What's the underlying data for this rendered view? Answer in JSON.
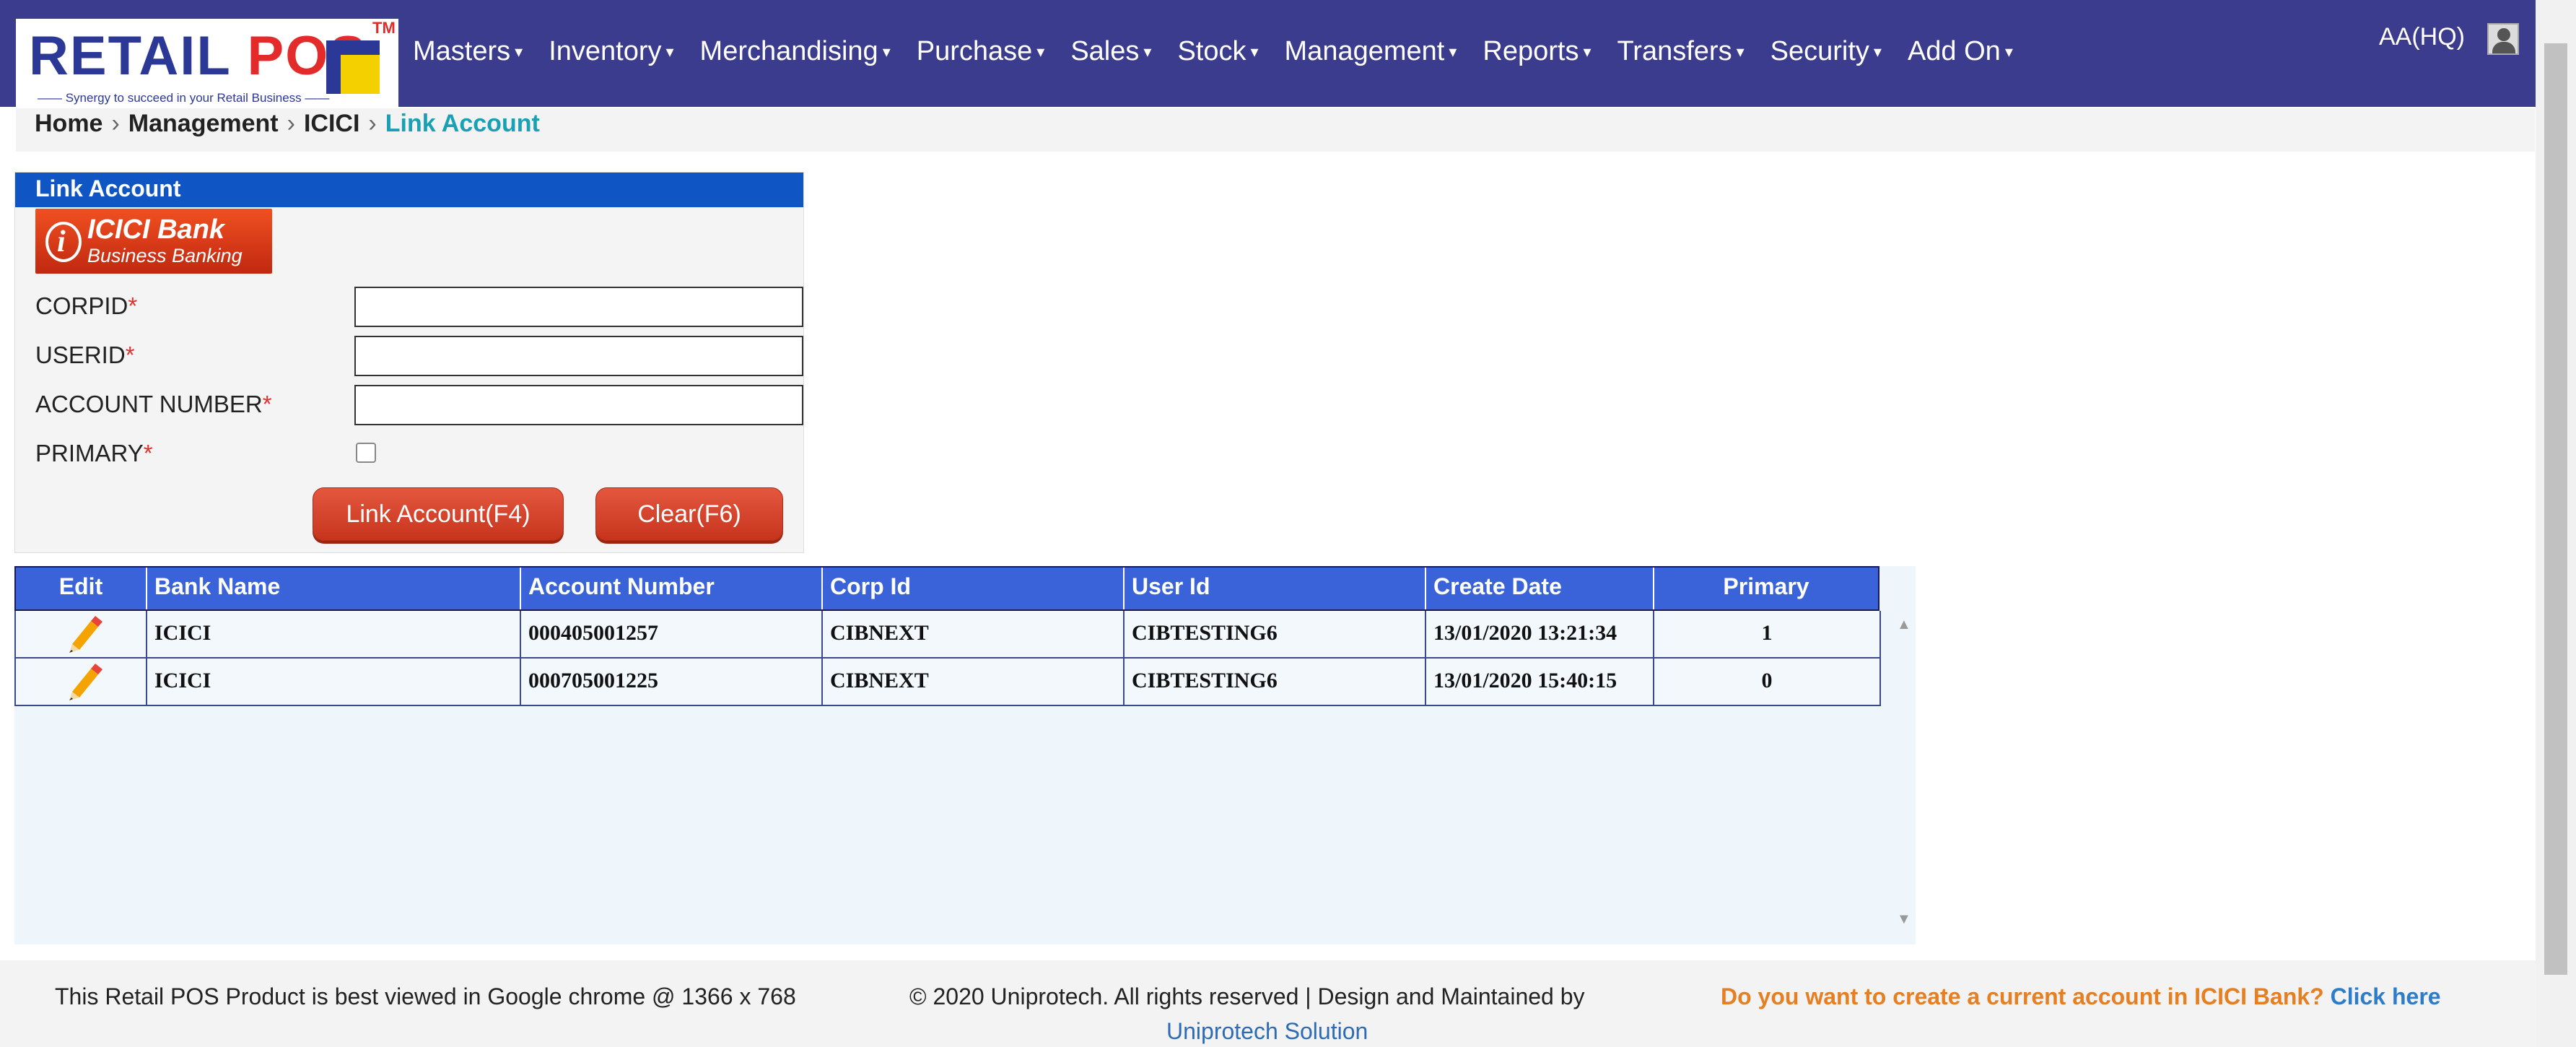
{
  "logo": {
    "word1": "RETAIL",
    "word2": "POS",
    "tm": "TM",
    "tagline": "—— Synergy to succeed in your Retail Business ——"
  },
  "nav": {
    "items": [
      {
        "label": "Masters"
      },
      {
        "label": "Inventory"
      },
      {
        "label": "Merchandising"
      },
      {
        "label": "Purchase"
      },
      {
        "label": "Sales"
      },
      {
        "label": "Stock"
      },
      {
        "label": "Management"
      },
      {
        "label": "Reports"
      },
      {
        "label": "Transfers"
      },
      {
        "label": "Security"
      },
      {
        "label": "Add On"
      }
    ],
    "caret": "▾",
    "user": "AA(HQ)",
    "avatar_icon": "user-avatar-icon"
  },
  "breadcrumb": {
    "items": [
      "Home",
      "Management",
      "ICICI",
      "Link Account"
    ],
    "separator": "›"
  },
  "panel": {
    "title": "Link Account",
    "bank_logo": {
      "line1": "ICICI Bank",
      "line2": "Business Banking",
      "letter": "i"
    },
    "fields": {
      "corpid": {
        "label": "CORPID",
        "value": ""
      },
      "userid": {
        "label": "USERID",
        "value": ""
      },
      "account_number": {
        "label": "ACCOUNT NUMBER",
        "value": ""
      },
      "primary": {
        "label": "PRIMARY",
        "checked": false
      }
    },
    "required_mark": "*",
    "buttons": {
      "link": "Link Account(F4)",
      "clear": "Clear(F6)"
    }
  },
  "grid": {
    "columns": [
      "Edit",
      "Bank Name",
      "Account Number",
      "Corp Id",
      "User Id",
      "Create Date",
      "Primary"
    ],
    "rows": [
      {
        "bank": "ICICI",
        "account": "000405001257",
        "corp": "CIBNEXT",
        "user": "CIBTESTING6",
        "date": "13/01/2020 13:21:34",
        "primary": "1"
      },
      {
        "bank": "ICICI",
        "account": "000705001225",
        "corp": "CIBNEXT",
        "user": "CIBTESTING6",
        "date": "13/01/2020 15:40:15",
        "primary": "0"
      }
    ],
    "scroll_up": "▲",
    "scroll_down": "▼"
  },
  "footer": {
    "left": "This Retail POS Product is best viewed in Google chrome @ 1366 x 768",
    "copyright": "© 2020 Uniprotech. All rights reserved | Design and Maintained by",
    "company": "Uniprotech Solution",
    "promo": "Do you want to create a current account in ICICI Bank?",
    "click": "Click here"
  },
  "colors": {
    "navbar": "#3b3c8e",
    "panel_header": "#0f55c4",
    "grid_header": "#3a63d9",
    "button": "#d5452c",
    "crumb_active": "#1aa0b4",
    "promo": "#e67e22"
  }
}
